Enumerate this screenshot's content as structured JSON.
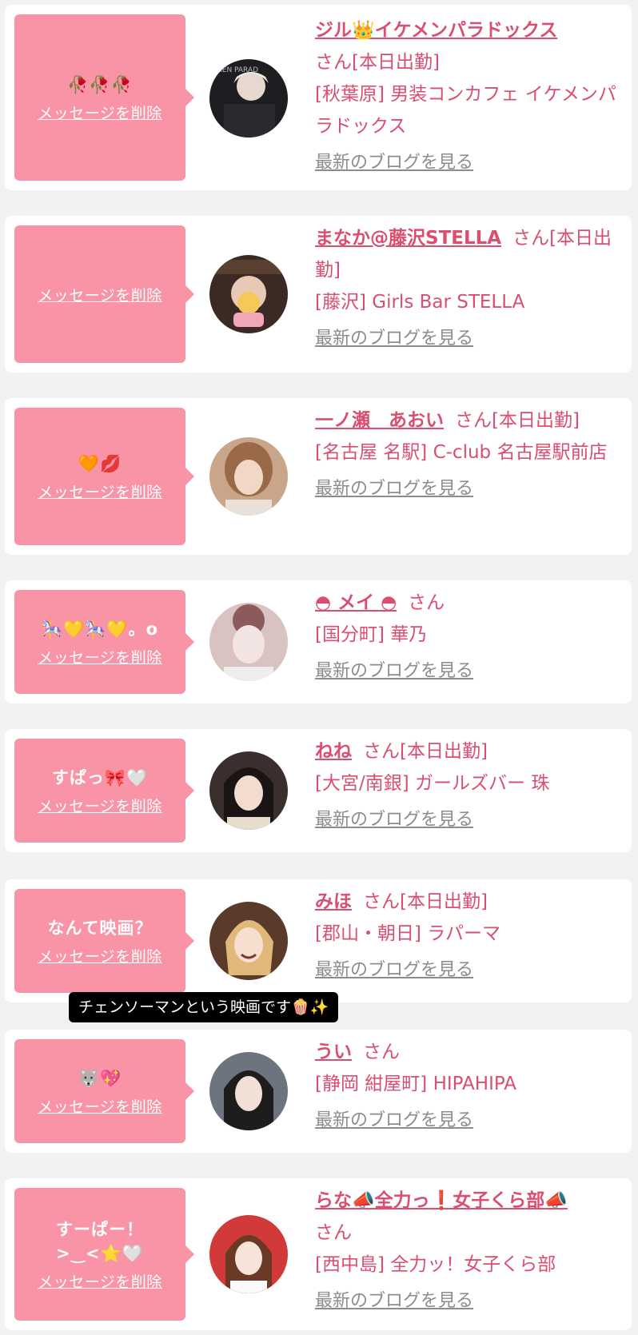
{
  "delete_label": "メッセージを削除",
  "blog_label": "最新のブログを見る",
  "san": "さん",
  "tooltip": "チェンソーマンという映画です🍿✨",
  "cards": [
    {
      "message": "🥀🥀🥀",
      "name": "ジル👑イケメンパラドックス",
      "status": "[本日出勤]",
      "shop": "[秋葉原] 男装コンカフェ イケメンパラドックス"
    },
    {
      "message": "",
      "name": "まなか@藤沢STELLA",
      "status": "[本日出勤]",
      "shop": "[藤沢] Girls Bar STELLA"
    },
    {
      "message": "🧡💋",
      "name": "一ノ瀬　あおい",
      "status": "[本日出勤]",
      "shop": "[名古屋 名駅] C-club 名古屋駅前店"
    },
    {
      "message": "🎠💛🎠💛。o",
      "name": "◓ メイ ◓",
      "status": "",
      "shop": "[国分町] 華乃"
    },
    {
      "message": "すぱっ🎀🤍",
      "name": "ねね",
      "status": "[本日出勤]",
      "shop": "[大宮/南銀] ガールズバー 珠"
    },
    {
      "message": "なんて映画？",
      "name": "みほ",
      "status": "[本日出勤]",
      "shop": "[郡山・朝日] ラパーマ"
    },
    {
      "message": "🐺💖",
      "name": "うい",
      "status": "",
      "shop": "[静岡 紺屋町] HIPAHIPA"
    },
    {
      "message": "すーぱー！>‿<⭐🤍",
      "name": "らな📣全力っ❗女子くら部📣",
      "status": "",
      "shop": "[西中島] 全力ッ！女子くら部"
    }
  ],
  "colors": {
    "bubble": "#f993a6",
    "link": "#d94f70",
    "muted": "#8c8c8c",
    "background": "#f2f2f2"
  }
}
